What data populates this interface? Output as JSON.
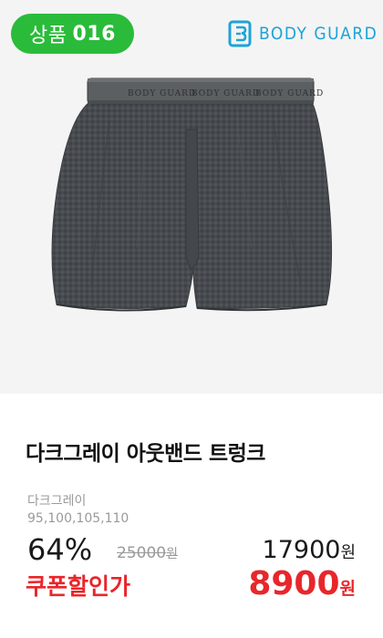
{
  "badge": {
    "prefix": "상품",
    "number": "016"
  },
  "brand": {
    "name": "BODY GUARD",
    "color": "#1da3d8",
    "icon": "bodyguard-logo-icon"
  },
  "image": {
    "waistband_text": "BODY GUARD",
    "garment_color": "#474b4f"
  },
  "product": {
    "title": "다크그레이 아웃밴드 트렁크",
    "color": "다크그레이",
    "sizes": "95,100,105,110"
  },
  "pricing": {
    "discount_percent": "64%",
    "original_price": "25000",
    "original_unit": "원",
    "price": "17900",
    "price_unit": "원",
    "coupon_label": "쿠폰할인가",
    "coupon_price": "8900",
    "coupon_unit": "원",
    "accent_color": "#e8262b",
    "badge_color": "#2bbb3a"
  }
}
